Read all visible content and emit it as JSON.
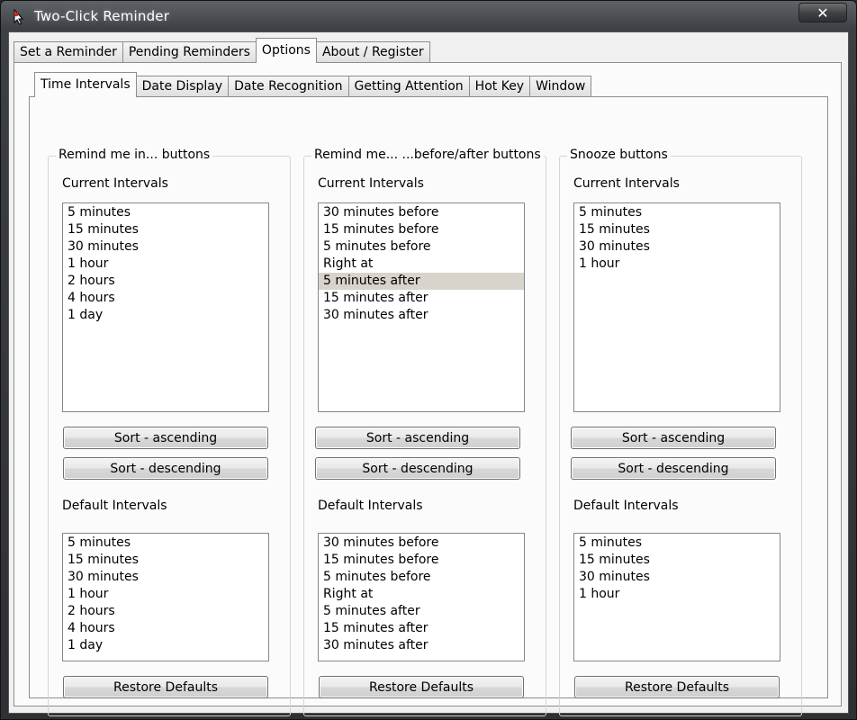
{
  "window": {
    "title": "Two-Click Reminder",
    "close_label": "✕"
  },
  "top_tabs": [
    "Set a Reminder",
    "Pending Reminders",
    "Options",
    "About / Register"
  ],
  "active_top_tab": "Options",
  "sub_tabs": [
    "Time Intervals",
    "Date Display",
    "Date Recognition",
    "Getting Attention",
    "Hot Key",
    "Window"
  ],
  "active_sub_tab": "Time Intervals",
  "groups": [
    {
      "title": "Remind me in... buttons",
      "current_label": "Current Intervals",
      "current_items": [
        "5 minutes",
        "15 minutes",
        "30 minutes",
        "1 hour",
        "2 hours",
        "4 hours",
        "1 day"
      ],
      "selected_item": "",
      "sort_asc_label": "Sort - ascending",
      "sort_desc_label": "Sort - descending",
      "default_label": "Default Intervals",
      "default_items": [
        "5 minutes",
        "15 minutes",
        "30 minutes",
        "1 hour",
        "2 hours",
        "4 hours",
        "1 day"
      ],
      "restore_label": "Restore Defaults"
    },
    {
      "title": "Remind me... ...before/after buttons",
      "current_label": "Current Intervals",
      "current_items": [
        "30 minutes before",
        "15 minutes before",
        "5 minutes before",
        "Right at",
        "5 minutes after",
        "15 minutes after",
        "30 minutes after"
      ],
      "selected_item": "5 minutes after",
      "sort_asc_label": "Sort - ascending",
      "sort_desc_label": "Sort - descending",
      "default_label": "Default Intervals",
      "default_items": [
        "30 minutes before",
        "15 minutes before",
        "5 minutes before",
        "Right at",
        "5 minutes after",
        "15 minutes after",
        "30 minutes after"
      ],
      "restore_label": "Restore Defaults"
    },
    {
      "title": "Snooze buttons",
      "current_label": "Current Intervals",
      "current_items": [
        "5 minutes",
        "15 minutes",
        "30 minutes",
        "1 hour"
      ],
      "selected_item": "",
      "sort_asc_label": "Sort - ascending",
      "sort_desc_label": "Sort - descending",
      "default_label": "Default Intervals",
      "default_items": [
        "5 minutes",
        "15 minutes",
        "30 minutes",
        "1 hour"
      ],
      "restore_label": "Restore Defaults"
    }
  ]
}
